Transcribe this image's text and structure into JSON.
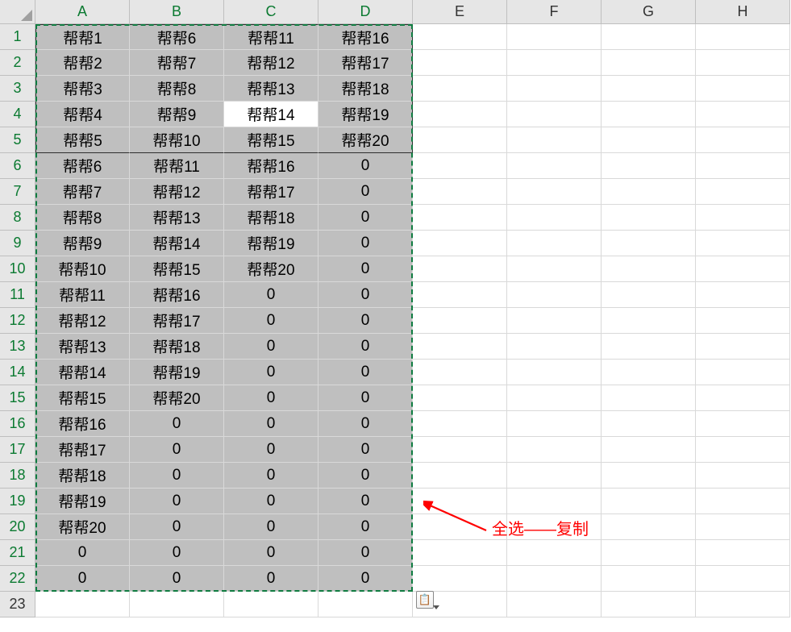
{
  "columns": [
    "A",
    "B",
    "C",
    "D",
    "E",
    "F",
    "G",
    "H"
  ],
  "rowCount": 23,
  "selection": {
    "startRow": 1,
    "endRow": 22,
    "startCol": 1,
    "endCol": 4
  },
  "activeCell": {
    "row": 4,
    "col": 3
  },
  "boxRange": {
    "startRow": 1,
    "endRow": 5,
    "startCol": 1,
    "endCol": 4
  },
  "annotation": {
    "text": "全选——复制"
  },
  "pasteIconGlyph": "📋",
  "chart_data": {
    "type": "table",
    "columns": [
      "A",
      "B",
      "C",
      "D"
    ],
    "rows": [
      [
        "帮帮1",
        "帮帮6",
        "帮帮11",
        "帮帮16"
      ],
      [
        "帮帮2",
        "帮帮7",
        "帮帮12",
        "帮帮17"
      ],
      [
        "帮帮3",
        "帮帮8",
        "帮帮13",
        "帮帮18"
      ],
      [
        "帮帮4",
        "帮帮9",
        "帮帮14",
        "帮帮19"
      ],
      [
        "帮帮5",
        "帮帮10",
        "帮帮15",
        "帮帮20"
      ],
      [
        "帮帮6",
        "帮帮11",
        "帮帮16",
        "0"
      ],
      [
        "帮帮7",
        "帮帮12",
        "帮帮17",
        "0"
      ],
      [
        "帮帮8",
        "帮帮13",
        "帮帮18",
        "0"
      ],
      [
        "帮帮9",
        "帮帮14",
        "帮帮19",
        "0"
      ],
      [
        "帮帮10",
        "帮帮15",
        "帮帮20",
        "0"
      ],
      [
        "帮帮11",
        "帮帮16",
        "0",
        "0"
      ],
      [
        "帮帮12",
        "帮帮17",
        "0",
        "0"
      ],
      [
        "帮帮13",
        "帮帮18",
        "0",
        "0"
      ],
      [
        "帮帮14",
        "帮帮19",
        "0",
        "0"
      ],
      [
        "帮帮15",
        "帮帮20",
        "0",
        "0"
      ],
      [
        "帮帮16",
        "0",
        "0",
        "0"
      ],
      [
        "帮帮17",
        "0",
        "0",
        "0"
      ],
      [
        "帮帮18",
        "0",
        "0",
        "0"
      ],
      [
        "帮帮19",
        "0",
        "0",
        "0"
      ],
      [
        "帮帮20",
        "0",
        "0",
        "0"
      ],
      [
        "0",
        "0",
        "0",
        "0"
      ],
      [
        "0",
        "0",
        "0",
        "0"
      ]
    ]
  }
}
